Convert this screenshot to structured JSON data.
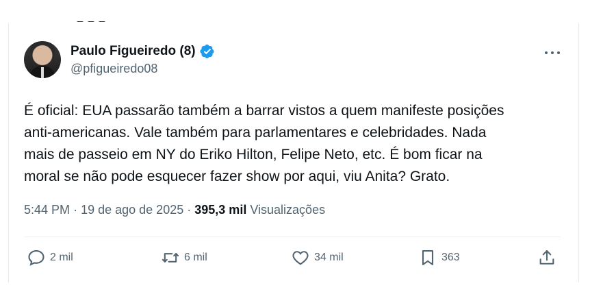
{
  "tweet": {
    "author": {
      "display_name": "Paulo Figueiredo (8)",
      "handle": "@pfigueiredo08",
      "verified": true
    },
    "more_icon": "more-horizontal-icon",
    "text": "É oficial: EUA passarão também a barrar vistos a quem manifeste posições\nanti-americanas. Vale também para parlamentares e celebridades. Nada\nmais de passeio em NY do Eriko Hilton, Felipe Neto, etc. É bom ficar na\nmoral se não pode esquecer fazer show por aqui, viu Anita? Grato.",
    "meta": {
      "time": "5:44 PM",
      "separator": "·",
      "date": "19 de ago de 2025",
      "views_count": "395,3 mil",
      "views_label": "Visualizações"
    },
    "actions": {
      "replies": "2 mil",
      "reposts": "6 mil",
      "likes": "34 mil",
      "bookmarks": "363"
    }
  },
  "colors": {
    "verified": "#1d9bf0",
    "text": "#0f1419",
    "secondary": "#536471"
  }
}
